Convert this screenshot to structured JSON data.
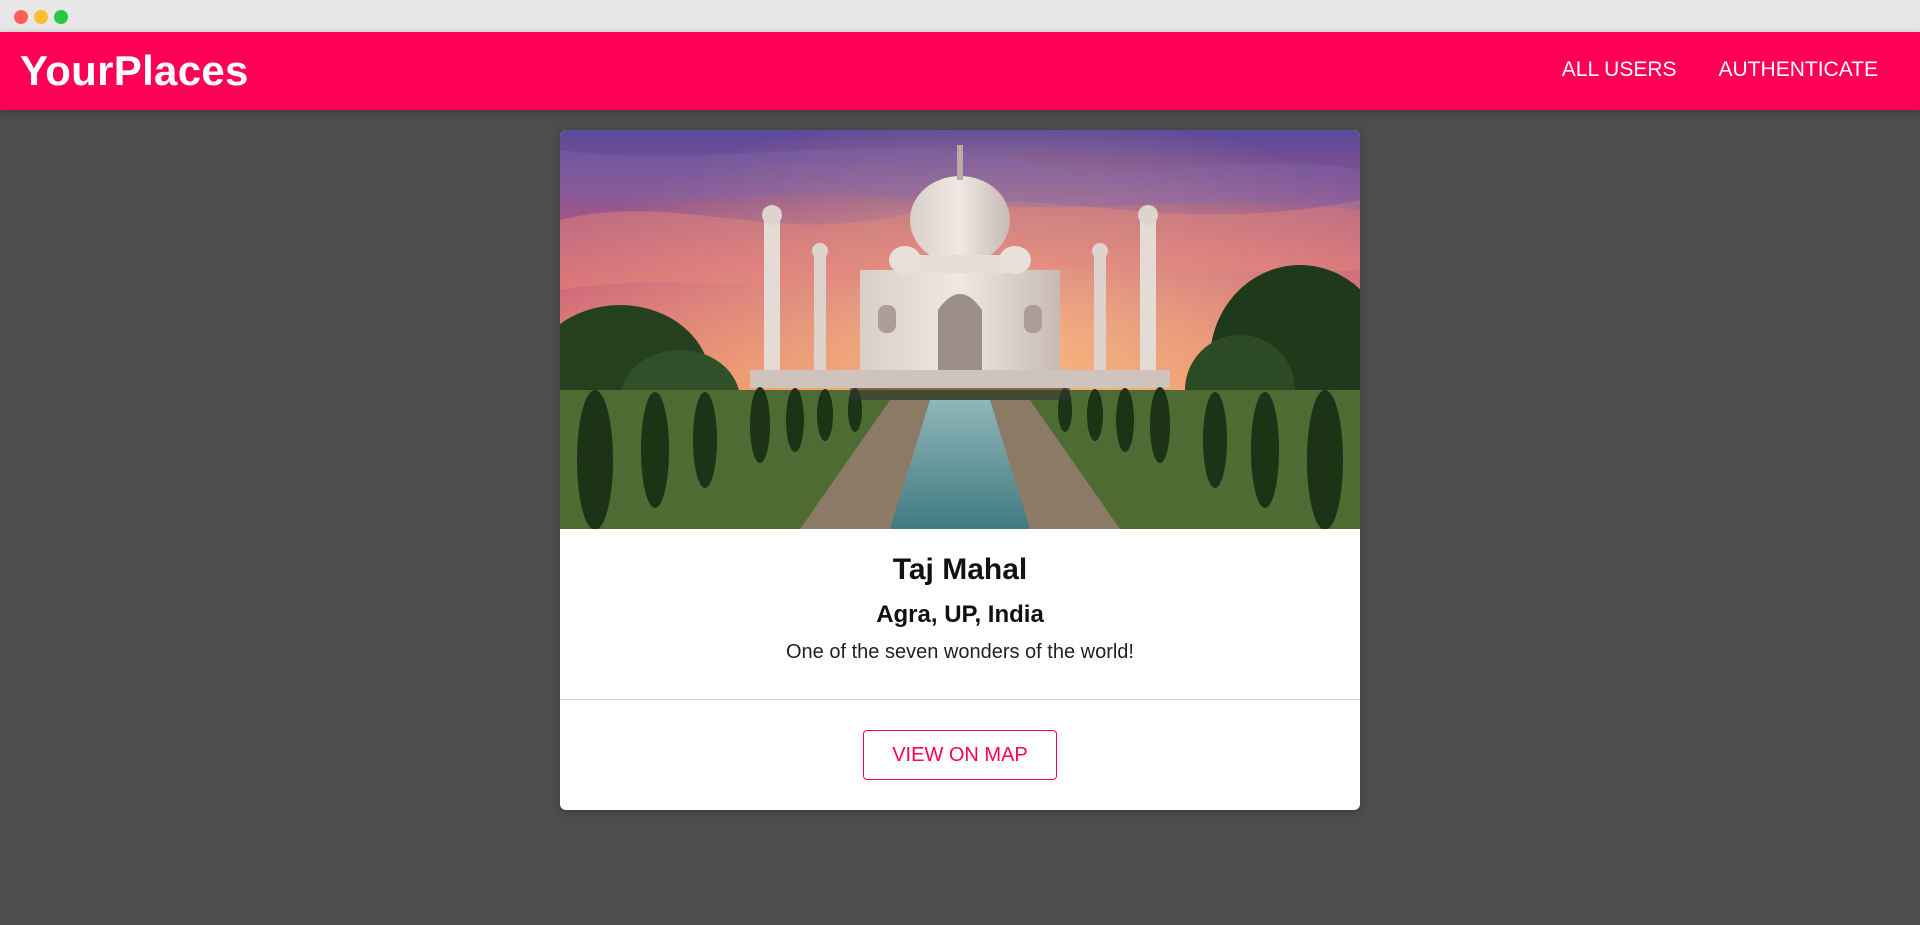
{
  "app": {
    "title": "YourPlaces"
  },
  "nav": {
    "items": [
      "ALL USERS",
      "AUTHENTICATE"
    ]
  },
  "place": {
    "title": "Taj Mahal",
    "address": "Agra, UP, India",
    "description": "One of the seven wonders of the world!"
  },
  "actions": {
    "view_on_map": "VIEW ON MAP"
  },
  "colors": {
    "accent": "#ff0055",
    "background": "#4d4d4d",
    "card": "#ffffff"
  }
}
